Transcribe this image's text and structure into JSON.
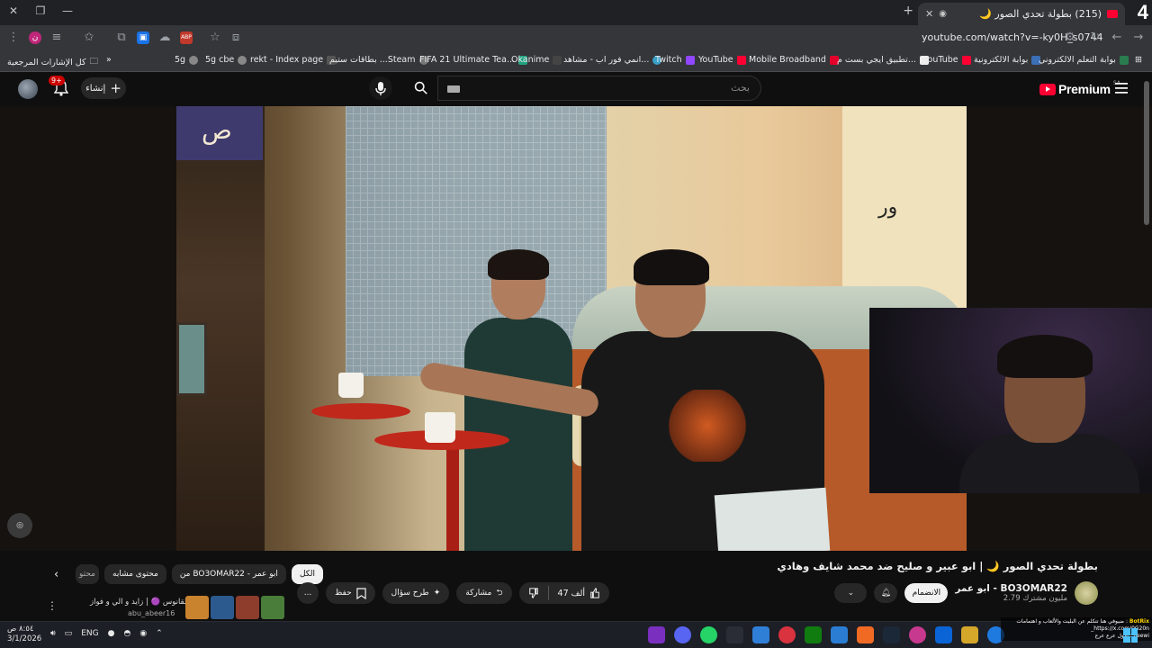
{
  "browser": {
    "tab": {
      "title": "(215) بطولة تحدي الصور 🌙"
    },
    "profile_number": "4",
    "new_tab_symbol": "+",
    "url": "youtube.com/watch?v=-ky0H_s0744",
    "bookmarks": [
      {
        "label": "بوابة التعلم الالكتروني",
        "color": "#2a7d4f"
      },
      {
        "label": "بوابة الالكترونية",
        "color": "#3b6fb6"
      },
      {
        "label": "YouTube",
        "color": "#ff0033"
      },
      {
        "label": "تطبيق ايجي بست م...",
        "color": "#eeeeee"
      },
      {
        "label": "Mobile Broadband",
        "color": "#e4002b"
      },
      {
        "label": "YouTube",
        "color": "#ff0033"
      },
      {
        "label": "Twitch",
        "color": "#9146ff"
      },
      {
        "label": "انمي فور اب - مشاهد...",
        "color": "#39a0c8"
      },
      {
        "label": "Okanime",
        "color": "#444444"
      },
      {
        "label": "FIFA 21 Ultimate Tea...",
        "color": "#1fa37f"
      },
      {
        "label": "بطاقات ستيم ...Steam",
        "color": "#1b2838"
      },
      {
        "label": "rekt - Index page",
        "color": "#555555"
      },
      {
        "label": "5g cbe",
        "color": "#888888"
      },
      {
        "label": "5g",
        "color": "#888888"
      }
    ],
    "bookmarks_overflow": "»",
    "all_bookmarks": "كل الإشارات المرجعية"
  },
  "youtube": {
    "logo_text": "Premium",
    "logo_region": "SA",
    "search_placeholder": "بحث",
    "create_label": "إنشاء",
    "notification_count": "9+"
  },
  "video": {
    "title": "بطولة تحدي الصور 🌙 | ابو عبير و صليح ضد محمد شايف وهادي",
    "channel_name": "ابو عمر - BO3OMAR22",
    "subscribers": "2.79 مليون مشترك",
    "join_label": "الانضمام",
    "likes": "47 ألف",
    "share_label": "مشاركة",
    "ask_label": "طرح سؤال",
    "save_label": "حفظ",
    "more_label": "..."
  },
  "chips": [
    {
      "label": "الكل",
      "active": true
    },
    {
      "label": "من BO3OMAR22 - ابو عمر",
      "active": false
    },
    {
      "label": "محتوى مشابه",
      "active": false
    },
    {
      "label": "محتو",
      "active": false
    }
  ],
  "live_row": {
    "text": "القانوس 🟣 | زايد و الي و فواز",
    "handle": "abu_abeer16"
  },
  "taskbar": {
    "time": "٨:٥٤ ص",
    "date": "3/1/2026",
    "lang": "ENG",
    "notification_title": "BotRix",
    "notification_text": "ضيوفي هنا تتكلم عن البليت والألعاب و اهتمامات",
    "notification_link": "https://x.com/0G20n_",
    "notification_line3": "jleewi : الأول عرع عرع"
  },
  "colors": {
    "brand_red": "#ff0033",
    "background": "#0f0f0f",
    "chip_bg": "#272727"
  }
}
